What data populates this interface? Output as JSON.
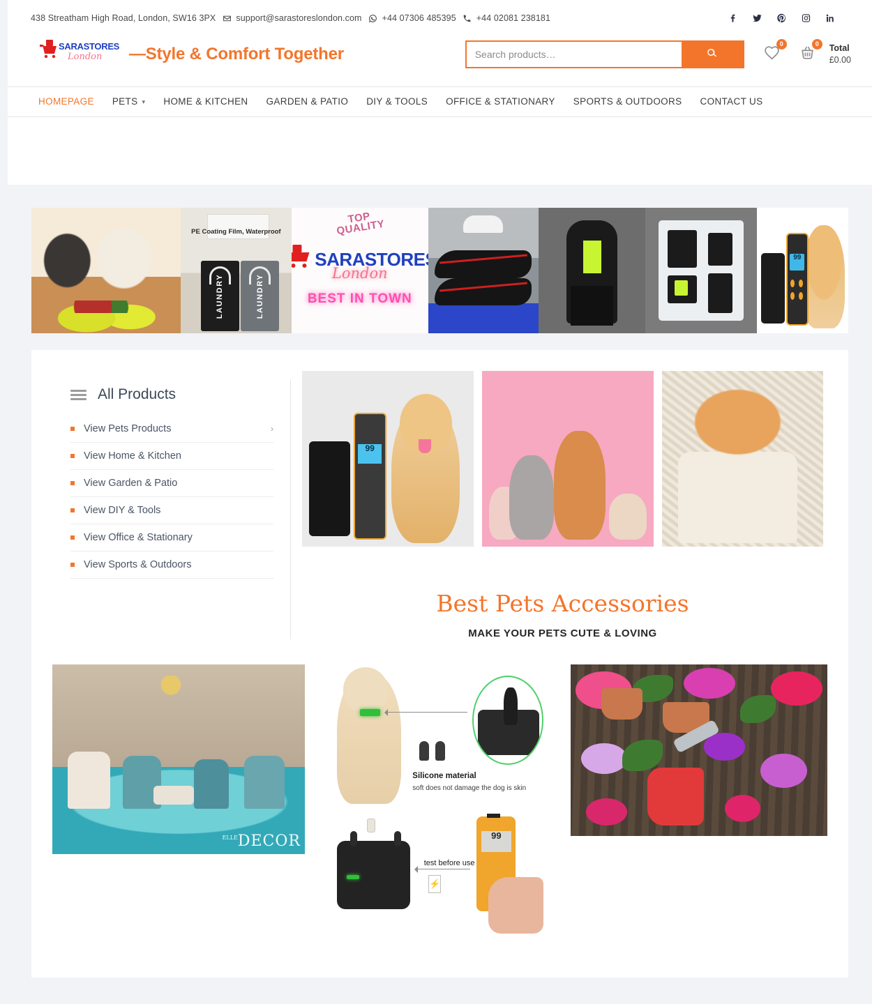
{
  "topbar": {
    "address": "438 Streatham High Road, London, SW16 3PX",
    "email": "support@sarastoreslondon.com",
    "whatsapp": "+44 07306 485395",
    "phone": "+44 02081 238181",
    "social": [
      {
        "name": "facebook-icon",
        "label": "Facebook"
      },
      {
        "name": "twitter-icon",
        "label": "Twitter"
      },
      {
        "name": "pinterest-icon",
        "label": "Pinterest"
      },
      {
        "name": "instagram-icon",
        "label": "Instagram"
      },
      {
        "name": "linkedin-icon",
        "label": "LinkedIn"
      }
    ]
  },
  "brand": {
    "name": "SARASTORES",
    "sub": "London",
    "tagline": "—Style & Comfort Together",
    "name_color": "#1f40bf",
    "sub_color": "#f6728e",
    "accent_color": "#f3752b"
  },
  "search": {
    "placeholder": "Search products…",
    "value": "",
    "button_icon": "search-icon"
  },
  "header_icons": {
    "wishlist_count": "0",
    "cart_count": "0",
    "total_label": "Total",
    "total_value": "£0.00"
  },
  "nav": {
    "items": [
      {
        "label": "HOMEPAGE",
        "active": true,
        "dropdown": false
      },
      {
        "label": "PETS",
        "active": false,
        "dropdown": true
      },
      {
        "label": "HOME & KITCHEN",
        "active": false,
        "dropdown": false
      },
      {
        "label": "GARDEN & PATIO",
        "active": false,
        "dropdown": false
      },
      {
        "label": "DIY & TOOLS",
        "active": false,
        "dropdown": false
      },
      {
        "label": "OFFICE & STATIONARY",
        "active": false,
        "dropdown": false
      },
      {
        "label": "SPORTS & OUTDOORS",
        "active": false,
        "dropdown": false
      },
      {
        "label": "CONTACT US",
        "active": false,
        "dropdown": false
      }
    ]
  },
  "banner": {
    "laundry_caption": "PE Coating Film, Waterproof",
    "laundry_word_1": "LAUNDRY",
    "laundry_word_2": "LAUNDRY",
    "badge_top": "TOP",
    "badge_quality": "QUALITY",
    "badge_best": "BEST IN TOWN",
    "collar_display": "99",
    "tiles": [
      {
        "name": "banner-pet-food",
        "alt": "Cat and dog eating from a yellow bowl"
      },
      {
        "name": "banner-laundry-baskets",
        "alt": "Two laundry hampers in a bathroom"
      },
      {
        "name": "banner-brand-card",
        "alt": "Sarastores London brand card"
      },
      {
        "name": "banner-running-shoes",
        "alt": "Black and red running shoes"
      },
      {
        "name": "banner-sportswear-model",
        "alt": "Man in black hooded sportswear"
      },
      {
        "name": "banner-sports-kit",
        "alt": "Compression sports kit set"
      },
      {
        "name": "banner-dog-collar",
        "alt": "Dog training collar with golden retriever"
      }
    ]
  },
  "sidebar": {
    "title": "All Products",
    "menu_icon": "hamburger-icon",
    "items": [
      {
        "label": "View Pets Products",
        "chevron": "›"
      },
      {
        "label": "View Home & Kitchen",
        "chevron": ""
      },
      {
        "label": "View Garden & Patio",
        "chevron": ""
      },
      {
        "label": "View DIY & Tools",
        "chevron": ""
      },
      {
        "label": "View Office & Stationary",
        "chevron": ""
      },
      {
        "label": "View Sports & Outdoors",
        "chevron": ""
      }
    ]
  },
  "showcase": {
    "tiles": [
      {
        "name": "tile-dog-training-collar",
        "alt": "Dog training collar with remote and golden retriever",
        "display": "99"
      },
      {
        "name": "tile-pets-group-pink",
        "alt": "Poodle, corgi and cats on pink background"
      },
      {
        "name": "tile-kitten-sweater",
        "alt": "Ginger kitten in a knitted sweater"
      }
    ],
    "heading": "Best Pets Accessories",
    "subheading": "MAKE YOUR PETS CUTE & LOVING"
  },
  "bottom": {
    "decor": {
      "name": "image-living-room-decor",
      "watermark": "DECOR",
      "watermark_small": "ELLE"
    },
    "diagram1": {
      "name": "image-collar-silicone-detail",
      "caption_title": "Silicone material",
      "caption_sub": "soft does not damage the dog is skin"
    },
    "diagram2": {
      "name": "image-collar-test-before-use",
      "caption": "test before use",
      "remote_display": "99",
      "bolt_symbol": "⚡"
    },
    "garden": {
      "name": "image-garden-tools-flowers",
      "alt": "Gardening tools, gloves and flowers"
    }
  }
}
